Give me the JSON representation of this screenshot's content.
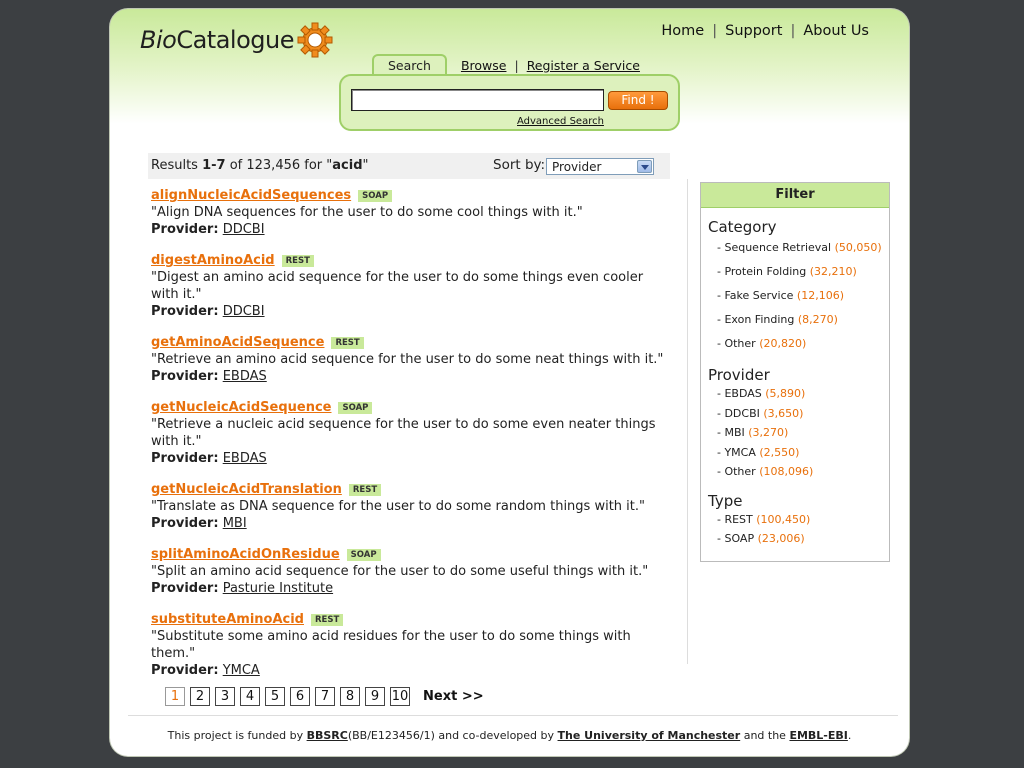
{
  "header": {
    "logo_bio": "Bio",
    "logo_catalogue": "Catalogue",
    "nav": [
      {
        "label": "Home"
      },
      {
        "label": "Support"
      },
      {
        "label": "About Us"
      }
    ]
  },
  "search": {
    "tabs": {
      "search": "Search",
      "browse": "Browse",
      "register": "Register a Service"
    },
    "input_value": "",
    "find_label": "Find !",
    "advanced_label": "Advanced Search"
  },
  "results_header": {
    "prefix": "Results ",
    "range": "1-7",
    "of_text": " of 123,456 for \"",
    "query": "acid",
    "suffix": "\"",
    "sort_label": "Sort by:",
    "sort_value": "Provider"
  },
  "results": [
    {
      "name": "alignNucleicAcidSequences",
      "type": "SOAP",
      "description": "\"Align DNA sequences for the user to do some cool things with it.\"",
      "provider_label": "Provider:",
      "provider": "DDCBI"
    },
    {
      "name": "digestAminoAcid",
      "type": "REST",
      "description": "\"Digest an amino acid sequence for the user to do some things even cooler with it.\"",
      "provider_label": "Provider:",
      "provider": "DDCBI"
    },
    {
      "name": "getAminoAcidSequence",
      "type": "REST",
      "description": "\"Retrieve an amino acid sequence for the user to do some neat things with it.\"",
      "provider_label": "Provider:",
      "provider": "EBDAS"
    },
    {
      "name": "getNucleicAcidSequence",
      "type": "SOAP",
      "description": "\"Retrieve a nucleic acid sequence for the user to do some even neater things with it.\"",
      "provider_label": "Provider:",
      "provider": "EBDAS"
    },
    {
      "name": "getNucleicAcidTranslation",
      "type": "REST",
      "description": "\"Translate as DNA sequence for the user to do some random things with it.\"",
      "provider_label": "Provider:",
      "provider": "MBI"
    },
    {
      "name": "splitAminoAcidOnResidue",
      "type": "SOAP",
      "description": "\"Split an amino acid sequence for the user to do some useful things with it.\"",
      "provider_label": "Provider:",
      "provider": "Pasturie Institute"
    },
    {
      "name": "substituteAminoAcid",
      "type": "REST",
      "description": "\"Substitute some amino acid residues for the user to do some things with them.\"",
      "provider_label": "Provider:",
      "provider": "YMCA"
    }
  ],
  "pagination": {
    "pages": [
      "1",
      "2",
      "3",
      "4",
      "5",
      "6",
      "7",
      "8",
      "9",
      "10"
    ],
    "current": "1",
    "next_label": "Next >>"
  },
  "filter": {
    "title": "Filter",
    "category_title": "Category",
    "categories": [
      {
        "label": "- Sequence Retrieval",
        "count": "(50,050)"
      },
      {
        "label": "- Protein Folding",
        "count": "(32,210)"
      },
      {
        "label": "- Fake Service",
        "count": "(12,106)"
      },
      {
        "label": "- Exon Finding",
        "count": "(8,270)"
      },
      {
        "label": "- Other",
        "count": "(20,820)"
      }
    ],
    "provider_title": "Provider",
    "providers": [
      {
        "label": "- EBDAS",
        "count": "(5,890)"
      },
      {
        "label": "- DDCBI",
        "count": "(3,650)"
      },
      {
        "label": "- MBI",
        "count": "(3,270)"
      },
      {
        "label": "- YMCA",
        "count": "(2,550)"
      },
      {
        "label": "- Other",
        "count": "(108,096)"
      }
    ],
    "type_title": "Type",
    "types": [
      {
        "label": "- REST",
        "count": "(100,450)"
      },
      {
        "label": "- SOAP",
        "count": "(23,006)"
      }
    ]
  },
  "footer": {
    "t1": "This project is funded by ",
    "l1": "BBSRC",
    "t2": "(BB/E123456/1) and co-developed by ",
    "l2": "The University of Manchester",
    "t3": " and the ",
    "l3": "EMBL-EBI",
    "t4": "."
  },
  "colors": {
    "accent_orange": "#e8700c",
    "brand_green": "#c9e99a",
    "background": "#3c3f42"
  }
}
